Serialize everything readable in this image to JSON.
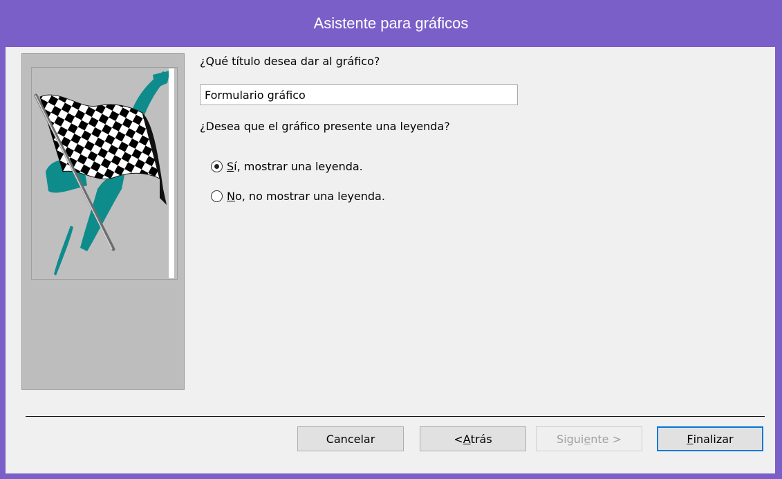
{
  "window": {
    "title": "Asistente para gráficos"
  },
  "question_title": {
    "pre": "",
    "accel": "¿",
    "post": "Qué título desea dar al gráfico?"
  },
  "title_input": {
    "value": "Formulario gráfico"
  },
  "question_legend": "¿Desea que el gráfico presente una leyenda?",
  "legend_options": [
    {
      "accel": "S",
      "rest": "í, mostrar una leyenda.",
      "checked": true
    },
    {
      "accel": "N",
      "rest": "o, no mostrar una leyenda.",
      "checked": false
    }
  ],
  "buttons": {
    "cancel": "Cancelar",
    "back": {
      "pre": "< ",
      "accel": "A",
      "post": "trás"
    },
    "next": {
      "pre": "Sigui",
      "accel": "e",
      "post": "nte >"
    },
    "finish": {
      "pre": "",
      "accel": "F",
      "post": "inalizar"
    }
  },
  "colors": {
    "title_bar": "#7b5fc8",
    "flag_teal": "#0e8c8c"
  },
  "icons": {
    "wizard_art": "checkered-flag"
  }
}
